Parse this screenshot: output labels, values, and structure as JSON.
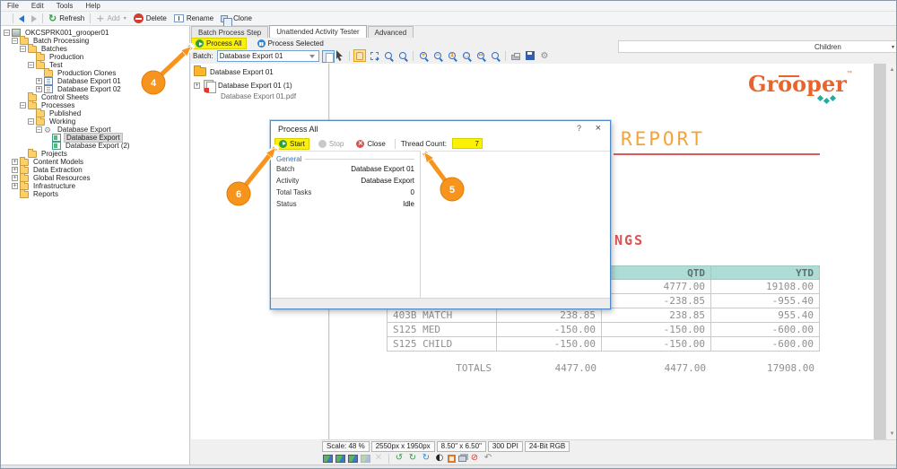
{
  "menu": {
    "items": [
      "File",
      "Edit",
      "Tools",
      "Help"
    ]
  },
  "toolbar": {
    "buttons": [
      {
        "icon": "app-window-icon",
        "label": "",
        "disabled": false
      },
      {
        "icon": "back-icon",
        "label": "",
        "disabled": false
      },
      {
        "icon": "forward-icon",
        "label": "",
        "disabled": true
      },
      {
        "icon": "refresh-icon",
        "label": "Refresh",
        "disabled": false
      },
      {
        "icon": "add-icon",
        "label": "Add",
        "disabled": true,
        "dropdown": true
      },
      {
        "icon": "delete-icon",
        "label": "Delete",
        "disabled": false
      },
      {
        "icon": "rename-icon",
        "label": "Rename",
        "disabled": false
      },
      {
        "icon": "clone-icon",
        "label": "Clone",
        "disabled": false
      }
    ]
  },
  "tree": {
    "items": [
      {
        "label": "OKCSPRK001_grooper01",
        "depth": 0,
        "exp": "-",
        "icon": "server",
        "selected": false
      },
      {
        "label": "Batch Processing",
        "depth": 1,
        "exp": "-",
        "icon": "folder",
        "selected": false
      },
      {
        "label": "Batches",
        "depth": 2,
        "exp": "-",
        "icon": "folder",
        "selected": false
      },
      {
        "label": "Production",
        "depth": 3,
        "exp": "",
        "icon": "folder",
        "selected": false
      },
      {
        "label": "Test",
        "depth": 3,
        "exp": "-",
        "icon": "folder",
        "selected": false
      },
      {
        "label": "Production Clones",
        "depth": 4,
        "exp": "",
        "icon": "folder",
        "selected": false
      },
      {
        "label": "Database Export 01",
        "depth": 4,
        "exp": "+",
        "icon": "batch",
        "selected": false
      },
      {
        "label": "Database Export 02",
        "depth": 4,
        "exp": "+",
        "icon": "batch",
        "selected": false
      },
      {
        "label": "Control Sheets",
        "depth": 2,
        "exp": "",
        "icon": "folder",
        "selected": false
      },
      {
        "label": "Processes",
        "depth": 2,
        "exp": "-",
        "icon": "folder",
        "selected": false
      },
      {
        "label": "Published",
        "depth": 3,
        "exp": "",
        "icon": "folder",
        "selected": false
      },
      {
        "label": "Working",
        "depth": 3,
        "exp": "-",
        "icon": "folder",
        "selected": false
      },
      {
        "label": "Database Export",
        "depth": 4,
        "exp": "-",
        "icon": "gear",
        "selected": false
      },
      {
        "label": "Database Export",
        "depth": 5,
        "exp": "",
        "icon": "process",
        "selected": true
      },
      {
        "label": "Database Export (2)",
        "depth": 5,
        "exp": "",
        "icon": "process",
        "selected": false
      },
      {
        "label": "Projects",
        "depth": 2,
        "exp": "",
        "icon": "folder",
        "selected": false
      },
      {
        "label": "Content Models",
        "depth": 1,
        "exp": "+",
        "icon": "folder",
        "selected": false
      },
      {
        "label": "Data Extraction",
        "depth": 1,
        "exp": "+",
        "icon": "folder",
        "selected": false
      },
      {
        "label": "Global Resources",
        "depth": 1,
        "exp": "+",
        "icon": "folder",
        "selected": false
      },
      {
        "label": "Infrastructure",
        "depth": 1,
        "exp": "+",
        "icon": "folder",
        "selected": false
      },
      {
        "label": "Reports",
        "depth": 1,
        "exp": "",
        "icon": "folder",
        "selected": false
      }
    ]
  },
  "tabs": {
    "items": [
      "Batch Process Step",
      "Unattended Activity Tester",
      "Advanced"
    ],
    "active": 1
  },
  "actions": {
    "process_all": "Process All",
    "process_selected": "Process Selected"
  },
  "batch_bar": {
    "label": "Batch:",
    "value": "Database Export 01"
  },
  "children_panel": {
    "label": "Children"
  },
  "batch_tree": {
    "folder": "Database Export 01",
    "document": "Database Export 01 (1)",
    "page": "Database Export 01.pdf"
  },
  "viewer_toolbar": {
    "icons": [
      "pointer-icon",
      "hand-icon",
      "marquee-add-icon",
      "zoom-select-icon",
      "zoom-page-icon",
      "zoom-in-icon",
      "zoom-out-icon",
      "zoom-actual-icon",
      "zoom-fit-icon",
      "zoom-width-icon",
      "zoom-dynamic-icon",
      "print-icon",
      "save-icon",
      "tools-icon"
    ]
  },
  "doc": {
    "logo": "Grooper",
    "logo_tm": "™",
    "title": "REPORT",
    "heading_fragment": "NGS",
    "table": {
      "headers": [
        "",
        "",
        "QTD",
        "YTD"
      ],
      "rows": [
        [
          "",
          "",
          "4777.00",
          "19108.00"
        ],
        [
          "",
          "",
          "-238.85",
          "-955.40"
        ],
        [
          "403B MATCH",
          "238.85",
          "238.85",
          "955.40"
        ],
        [
          "S125 MED",
          "-150.00",
          "-150.00",
          "-600.00"
        ],
        [
          "S125 CHILD",
          "-150.00",
          "-150.00",
          "-600.00"
        ]
      ],
      "totals_label": "TOTALS",
      "totals": [
        "4477.00",
        "4477.00",
        "17908.00"
      ]
    }
  },
  "dialog": {
    "title": "Process All",
    "help": "?",
    "close_x": "×",
    "buttons": {
      "start": "Start",
      "stop": "Stop",
      "close": "Close"
    },
    "thread_count_label": "Thread Count:",
    "thread_count_value": "7",
    "section": "General",
    "props": [
      {
        "k": "Batch",
        "v": "Database Export 01"
      },
      {
        "k": "Activity",
        "v": "Database Export"
      },
      {
        "k": "Total Tasks",
        "v": "0"
      },
      {
        "k": "Status",
        "v": "Idle"
      }
    ]
  },
  "status_bar": {
    "items": [
      "Scale: 48 %",
      "2550px x 1950px",
      "8.50\" x 6.50\"",
      "300 DPI",
      "24-Bit RGB"
    ]
  },
  "bottom_icons": [
    "image-icon",
    "image-alt-icon",
    "image-zoom-icon",
    "image-disabled-icon",
    "delete-disabled-icon",
    "rotate-ccw-icon",
    "rotate-cw-icon",
    "sync-icon",
    "contrast-icon",
    "crop-icon",
    "layers-icon",
    "blocked-icon",
    "undo-icon"
  ],
  "callouts": {
    "c4": "4",
    "c5": "5",
    "c6": "6"
  },
  "colors": {
    "highlight": "#fbf103",
    "accent_orange": "#f7941e",
    "table_header": "#aedcd6",
    "doc_red": "#e05050",
    "doc_orange": "#f4a339",
    "logo_orange": "#e8642c",
    "logo_teal": "#2ba8a0"
  }
}
